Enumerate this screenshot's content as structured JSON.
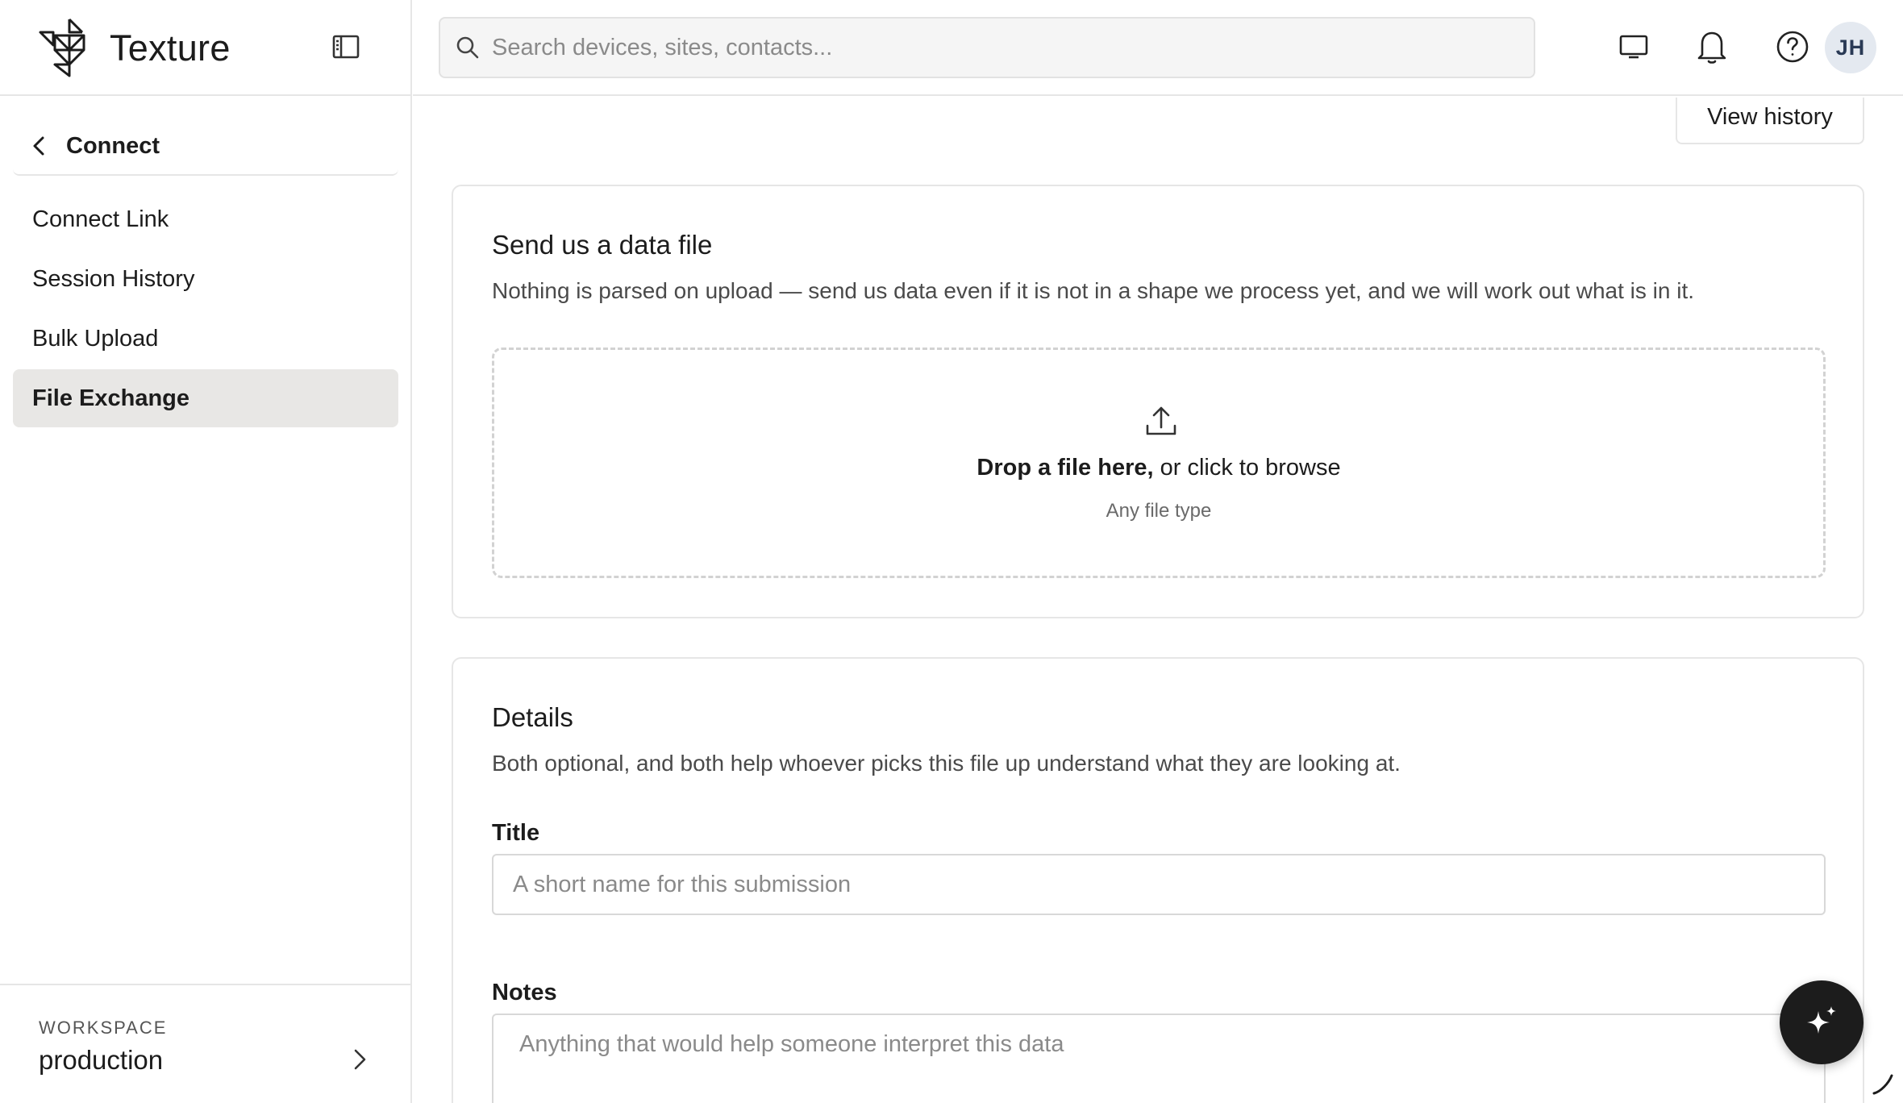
{
  "brand": {
    "name": "Texture"
  },
  "sidebar": {
    "back_label": "Connect",
    "items": [
      {
        "label": "Connect Link",
        "active": false
      },
      {
        "label": "Session History",
        "active": false
      },
      {
        "label": "Bulk Upload",
        "active": false
      },
      {
        "label": "File Exchange",
        "active": true
      }
    ],
    "workspace": {
      "caption": "WORKSPACE",
      "value": "production"
    }
  },
  "topbar": {
    "search_placeholder": "Search devices, sites, contacts...",
    "icons": [
      "monitor-icon",
      "bell-icon",
      "help-icon"
    ],
    "avatar_initials": "JH"
  },
  "main": {
    "view_history_label": "View history",
    "upload_card": {
      "title": "Send us a data file",
      "subtitle": "Nothing is parsed on upload — send us data even if it is not in a shape we process yet, and we will work out what is in it.",
      "drop_bold": "Drop a file here,",
      "drop_rest": " or click to browse",
      "drop_hint": "Any file type"
    },
    "details_card": {
      "title": "Details",
      "subtitle": "Both optional, and both help whoever picks this file up understand what they are looking at.",
      "title_label": "Title",
      "title_placeholder": "A short name for this submission",
      "notes_label": "Notes",
      "notes_placeholder": "Anything that would help someone interpret this data"
    }
  },
  "colors": {
    "active_nav_bg": "#e8e7e5",
    "fab_bg": "#1c1c1c",
    "avatar_bg": "#e4e9f0"
  }
}
